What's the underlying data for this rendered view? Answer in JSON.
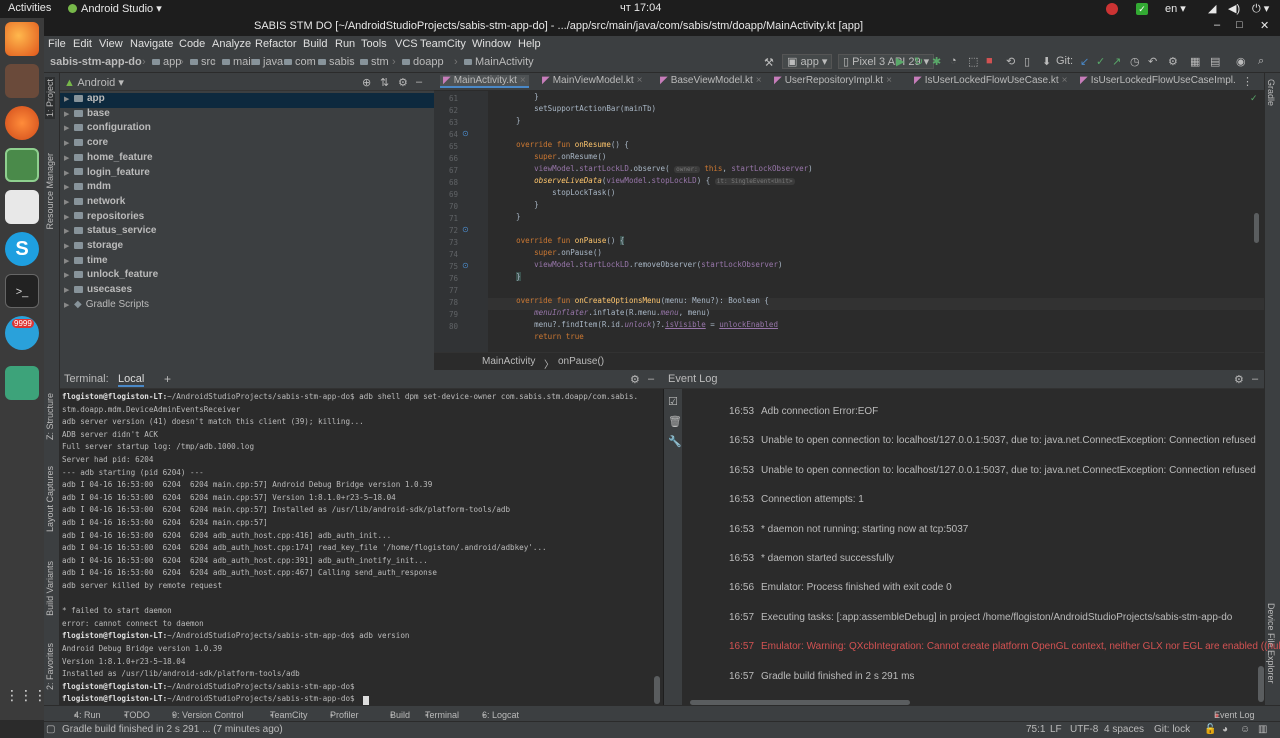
{
  "topbar": {
    "activities": "Activities",
    "app": "Android Studio",
    "clock": "чт 17:04",
    "lang": "en"
  },
  "window": {
    "title": "SABIS STM DO [~/AndroidStudioProjects/sabis-stm-app-do] - .../app/src/main/java/com/sabis/stm/doapp/MainActivity.kt [app]"
  },
  "menu": [
    "File",
    "Edit",
    "View",
    "Navigate",
    "Code",
    "Analyze",
    "Refactor",
    "Build",
    "Run",
    "Tools",
    "VCS",
    "TeamCity",
    "Window",
    "Help"
  ],
  "breadcrumb": [
    "sabis-stm-app-do",
    "app",
    "src",
    "main",
    "java",
    "com",
    "sabis",
    "stm",
    "doapp",
    "MainActivity"
  ],
  "toolbar": {
    "config": "app",
    "device": "Pixel 3 API 29",
    "git": "Git:"
  },
  "left_tools": {
    "project": "1: Project",
    "resource": "Resource Manager",
    "structure": "Z: Structure",
    "layout": "Layout Captures",
    "variants": "Build Variants",
    "favorites": "2: Favorites"
  },
  "right_tools": {
    "gradle": "Gradle",
    "device_file": "Device File Explorer"
  },
  "project": {
    "view": "Android",
    "items": [
      "app",
      "base",
      "configuration",
      "core",
      "home_feature",
      "login_feature",
      "mdm",
      "network",
      "repositories",
      "status_service",
      "storage",
      "time",
      "unlock_feature",
      "usecases",
      "Gradle Scripts"
    ]
  },
  "editor": {
    "tabs": [
      "MainActivity.kt",
      "MainViewModel.kt",
      "BaseViewModel.kt",
      "UserRepositoryImpl.kt",
      "IsUserLockedFlowUseCase.kt",
      "IsUserLockedFlowUseCaseImpl."
    ],
    "line_numbers": [
      "61",
      "62",
      "63",
      "64",
      "65",
      "66",
      "67",
      "68",
      "69",
      "70",
      "71",
      "72",
      "73",
      "74",
      "75",
      "76",
      "77",
      "78",
      "79",
      "80"
    ],
    "breadcrumb": [
      "MainActivity",
      "onPause()"
    ],
    "hints": {
      "owner": "owner:",
      "it": "it: SingleEvent<Unit>"
    }
  },
  "terminal": {
    "title": "Terminal:",
    "tab": "Local",
    "add": "+",
    "lines": [
      {
        "p": "flogiston@flogiston-LT:",
        "t": "~/AndroidStudioProjects/sabis-stm-app-do$ adb shell dpm set-device-owner com.sabis.stm.doapp/com.sabis."
      },
      {
        "p": "",
        "t": "stm.doapp.mdm.DeviceAdminEventsReceiver"
      },
      {
        "p": "",
        "t": "adb server version (41) doesn't match this client (39); killing..."
      },
      {
        "p": "",
        "t": "ADB server didn't ACK"
      },
      {
        "p": "",
        "t": "Full server startup log: /tmp/adb.1000.log"
      },
      {
        "p": "",
        "t": "Server had pid: 6204"
      },
      {
        "p": "",
        "t": "--- adb starting (pid 6204) ---"
      },
      {
        "p": "",
        "t": "adb I 04-16 16:53:00  6204  6204 main.cpp:57] Android Debug Bridge version 1.0.39"
      },
      {
        "p": "",
        "t": "adb I 04-16 16:53:00  6204  6204 main.cpp:57] Version 1:8.1.0+r23-5~18.04"
      },
      {
        "p": "",
        "t": "adb I 04-16 16:53:00  6204  6204 main.cpp:57] Installed as /usr/lib/android-sdk/platform-tools/adb"
      },
      {
        "p": "",
        "t": "adb I 04-16 16:53:00  6204  6204 main.cpp:57]"
      },
      {
        "p": "",
        "t": "adb I 04-16 16:53:00  6204  6204 adb_auth_host.cpp:416] adb_auth_init..."
      },
      {
        "p": "",
        "t": "adb I 04-16 16:53:00  6204  6204 adb_auth_host.cpp:174] read_key_file '/home/flogiston/.android/adbkey'..."
      },
      {
        "p": "",
        "t": "adb I 04-16 16:53:00  6204  6204 adb_auth_host.cpp:391] adb_auth_inotify_init..."
      },
      {
        "p": "",
        "t": "adb I 04-16 16:53:00  6204  6204 adb_auth_host.cpp:467] Calling send_auth_response"
      },
      {
        "p": "",
        "t": "adb server killed by remote request"
      },
      {
        "p": "",
        "t": ""
      },
      {
        "p": "",
        "t": "* failed to start daemon"
      },
      {
        "p": "",
        "t": "error: cannot connect to daemon"
      },
      {
        "p": "flogiston@flogiston-LT:",
        "t": "~/AndroidStudioProjects/sabis-stm-app-do$ adb version"
      },
      {
        "p": "",
        "t": "Android Debug Bridge version 1.0.39"
      },
      {
        "p": "",
        "t": "Version 1:8.1.0+r23-5~18.04"
      },
      {
        "p": "",
        "t": "Installed as /usr/lib/android-sdk/platform-tools/adb"
      },
      {
        "p": "flogiston@flogiston-LT:",
        "t": "~/AndroidStudioProjects/sabis-stm-app-do$"
      },
      {
        "p": "flogiston@flogiston-LT:",
        "t": "~/AndroidStudioProjects/sabis-stm-app-do$"
      }
    ]
  },
  "event_log": {
    "title": "Event Log",
    "entries": [
      {
        "time": "16:53",
        "msg": "Adb connection Error:EOF",
        "warn": false
      },
      {
        "time": "16:53",
        "msg": "Unable to open connection to: localhost/127.0.0.1:5037, due to: java.net.ConnectException: Connection refused",
        "warn": false
      },
      {
        "time": "16:53",
        "msg": "Unable to open connection to: localhost/127.0.0.1:5037, due to: java.net.ConnectException: Connection refused",
        "warn": false
      },
      {
        "time": "16:53",
        "msg": "Connection attempts: 1",
        "warn": false
      },
      {
        "time": "16:53",
        "msg": "* daemon not running; starting now at tcp:5037",
        "warn": false
      },
      {
        "time": "16:53",
        "msg": "* daemon started successfully",
        "warn": false
      },
      {
        "time": "16:56",
        "msg": "Emulator: Process finished with exit code 0",
        "warn": false
      },
      {
        "time": "16:57",
        "msg": "Executing tasks: [:app:assembleDebug] in project /home/flogiston/AndroidStudioProjects/sabis-stm-app-do",
        "warn": false
      },
      {
        "time": "16:57",
        "msg": "Emulator: Warning: QXcbIntegration: Cannot create platform OpenGL context, neither GLX nor EGL are enabled ((null):0,",
        "warn": true
      },
      {
        "time": "16:57",
        "msg": "Gradle build finished in 2 s 291 ms",
        "warn": false
      }
    ]
  },
  "bottom_tools": [
    "4: Run",
    "TODO",
    "9: Version Control",
    "TeamCity",
    "Profiler",
    "Build",
    "Terminal",
    "6: Logcat",
    "Event Log"
  ],
  "status": {
    "message": "Gradle build finished in 2 s 291 ... (7 minutes ago)",
    "position": "75:1",
    "line_sep": "LF",
    "encoding": "UTF-8",
    "indent": "4 spaces",
    "git": "Git: lock"
  },
  "badges": {
    "telegram": "9999"
  },
  "colors": {
    "accent": "#4a88c7",
    "warning": "#d25252",
    "selection": "#0d293e"
  }
}
